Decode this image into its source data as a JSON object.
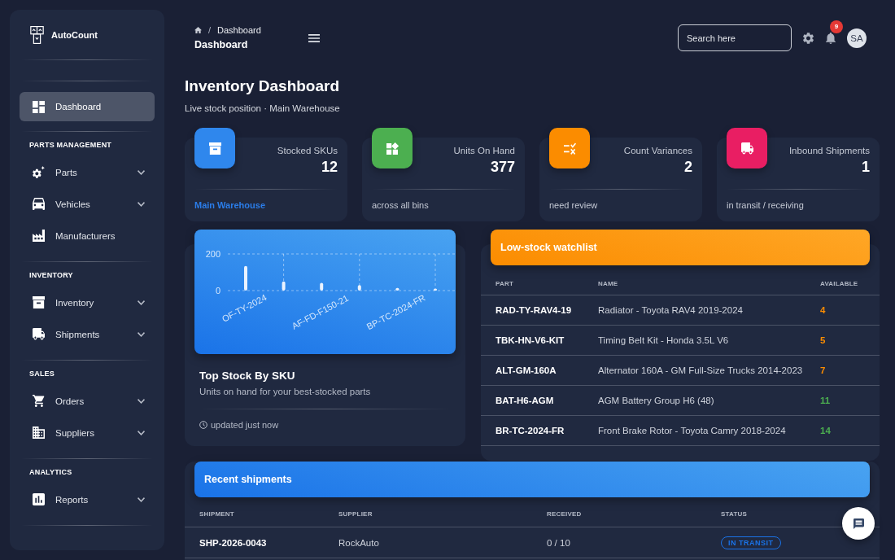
{
  "sidebar": {
    "brand": "AutoCount",
    "items": [
      {
        "label": "Dashboard",
        "selected": true,
        "has_submenu": false
      }
    ],
    "sections": [
      {
        "title": "PARTS MANAGEMENT",
        "items": [
          {
            "label": "Parts",
            "selected": false,
            "has_submenu": true
          },
          {
            "label": "Vehicles",
            "selected": false,
            "has_submenu": true
          },
          {
            "label": "Manufacturers",
            "selected": false,
            "has_submenu": false
          }
        ]
      },
      {
        "title": "INVENTORY",
        "items": [
          {
            "label": "Inventory",
            "selected": false,
            "has_submenu": true
          },
          {
            "label": "Shipments",
            "selected": false,
            "has_submenu": true
          }
        ]
      },
      {
        "title": "SALES",
        "items": [
          {
            "label": "Orders",
            "selected": false,
            "has_submenu": true
          },
          {
            "label": "Suppliers",
            "selected": false,
            "has_submenu": true
          }
        ]
      },
      {
        "title": "ANALYTICS",
        "items": [
          {
            "label": "Reports",
            "selected": false,
            "has_submenu": true
          }
        ]
      }
    ]
  },
  "navbar": {
    "breadcrumb": {
      "separator": "/",
      "current": "Dashboard"
    },
    "title": "Dashboard",
    "search": {
      "placeholder": "Search here"
    },
    "notifications": {
      "count": "9"
    },
    "user": {
      "initials": "SA"
    }
  },
  "page_header": {
    "title": "Inventory Dashboard",
    "subtitle": "Live stock position · Main Warehouse"
  },
  "stats": [
    {
      "label": "Stocked SKUs",
      "value": "12",
      "color": "#2f87ed",
      "footer": {
        "text": "Main Warehouse",
        "kind": "link"
      }
    },
    {
      "label": "Units On Hand",
      "value": "377",
      "color": "#4caf50",
      "footer": {
        "text": "across all bins",
        "kind": "note"
      }
    },
    {
      "label": "Count Variances",
      "value": "2",
      "color": "#fb8c00",
      "footer": {
        "text": "need review",
        "kind": "note"
      }
    },
    {
      "label": "Inbound Shipments",
      "value": "1",
      "color": "#e91e63",
      "footer": {
        "text": "in transit / receiving",
        "kind": "note"
      }
    }
  ],
  "top_stock": {
    "title": "Top Stock By SKU",
    "subtitle": "Units on hand for your best-stocked parts",
    "updated": "updated just now",
    "chart_data": {
      "type": "bar",
      "categories": [
        "OF-TY-2024",
        null,
        "AF-FD-F150-21",
        null,
        "BP-TC-2024-FR",
        null
      ],
      "values": [
        135,
        50,
        42,
        30,
        15,
        10
      ],
      "ylim": [
        0,
        200
      ],
      "yticks": [
        0,
        200
      ],
      "grid": true
    }
  },
  "watchlist": {
    "title": "Low-stock watchlist",
    "columns": [
      "PART",
      "NAME",
      "AVAILABLE"
    ],
    "rows": [
      {
        "part": "RAD-TY-RAV4-19",
        "name": "Radiator - Toyota RAV4 2019-2024",
        "available": "4",
        "color": "#fb8c00"
      },
      {
        "part": "TBK-HN-V6-KIT",
        "name": "Timing Belt Kit - Honda 3.5L V6",
        "available": "5",
        "color": "#fb8c00"
      },
      {
        "part": "ALT-GM-160A",
        "name": "Alternator 160A - GM Full-Size Trucks 2014-2023",
        "available": "7",
        "color": "#fb8c00"
      },
      {
        "part": "BAT-H6-AGM",
        "name": "AGM Battery Group H6 (48)",
        "available": "11",
        "color": "#4caf50"
      },
      {
        "part": "BR-TC-2024-FR",
        "name": "Front Brake Rotor - Toyota Camry 2018-2024",
        "available": "14",
        "color": "#4caf50"
      }
    ]
  },
  "shipments": {
    "title": "Recent shipments",
    "columns": [
      "SHIPMENT",
      "SUPPLIER",
      "RECEIVED",
      "STATUS"
    ],
    "rows": [
      {
        "shipment": "SHP-2026-0043",
        "supplier": "RockAuto",
        "received": "0 / 10",
        "status": "IN TRANSIT",
        "color": "#1a73e8"
      }
    ]
  }
}
